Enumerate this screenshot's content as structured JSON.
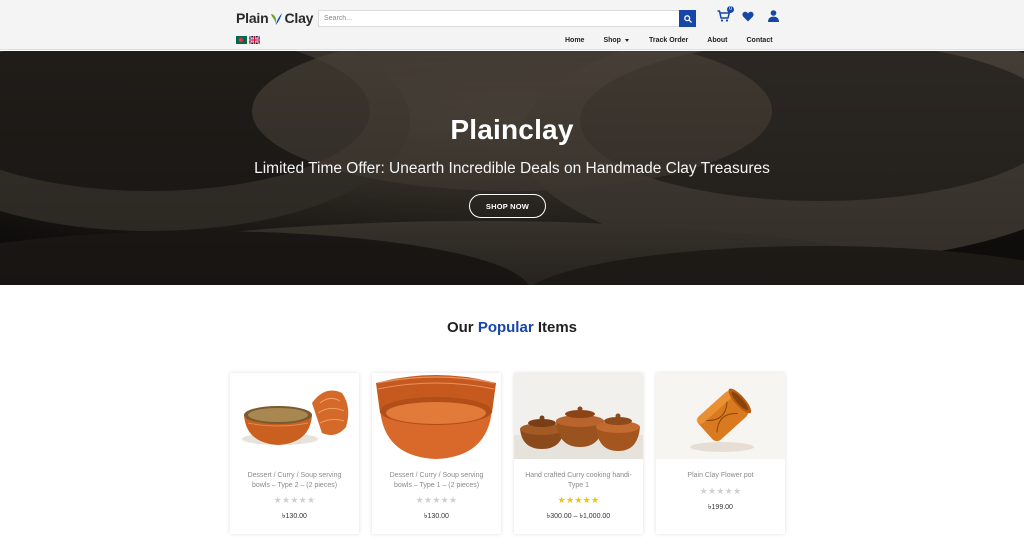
{
  "header": {
    "logo_left": "Plain",
    "logo_right": "Clay",
    "search_placeholder": "Search...",
    "cart_count": "0",
    "icons": [
      "search-icon",
      "cart-icon",
      "heart-icon",
      "user-icon"
    ],
    "accent_color": "#1646a6"
  },
  "flags": [
    "bangladesh-flag",
    "uk-flag"
  ],
  "nav": {
    "items": [
      {
        "label": "Home"
      },
      {
        "label": "Shop"
      },
      {
        "label": "Track Order"
      },
      {
        "label": "About"
      },
      {
        "label": "Contact"
      }
    ]
  },
  "hero": {
    "title": "Plainclay",
    "subtitle": "Limited Time Offer: Unearth Incredible Deals on Handmade Clay Treasures",
    "button_label": "SHOP NOW"
  },
  "section": {
    "title_before": "Our ",
    "title_highlight": "Popular",
    "title_after": " Items"
  },
  "products": [
    {
      "name": "Dessert / Curry / Soup serving bowls – Type 2 – (2 pieces)",
      "stars": "★★★★★",
      "rating": 0,
      "price": "৳130.00"
    },
    {
      "name": "Dessert / Curry / Soup serving bowls – Type 1 – (2 pieces)",
      "stars": "★★★★★",
      "rating": 0,
      "price": "৳130.00"
    },
    {
      "name": "Hand crafted Curry cooking handi- Type 1",
      "stars": "★★★★★",
      "rating": 5,
      "price": "৳300.00 – ৳1,000.00"
    },
    {
      "name": "Plain Clay Flower pot",
      "stars": "★★★★★",
      "rating": 0,
      "price": "৳199.00"
    }
  ]
}
